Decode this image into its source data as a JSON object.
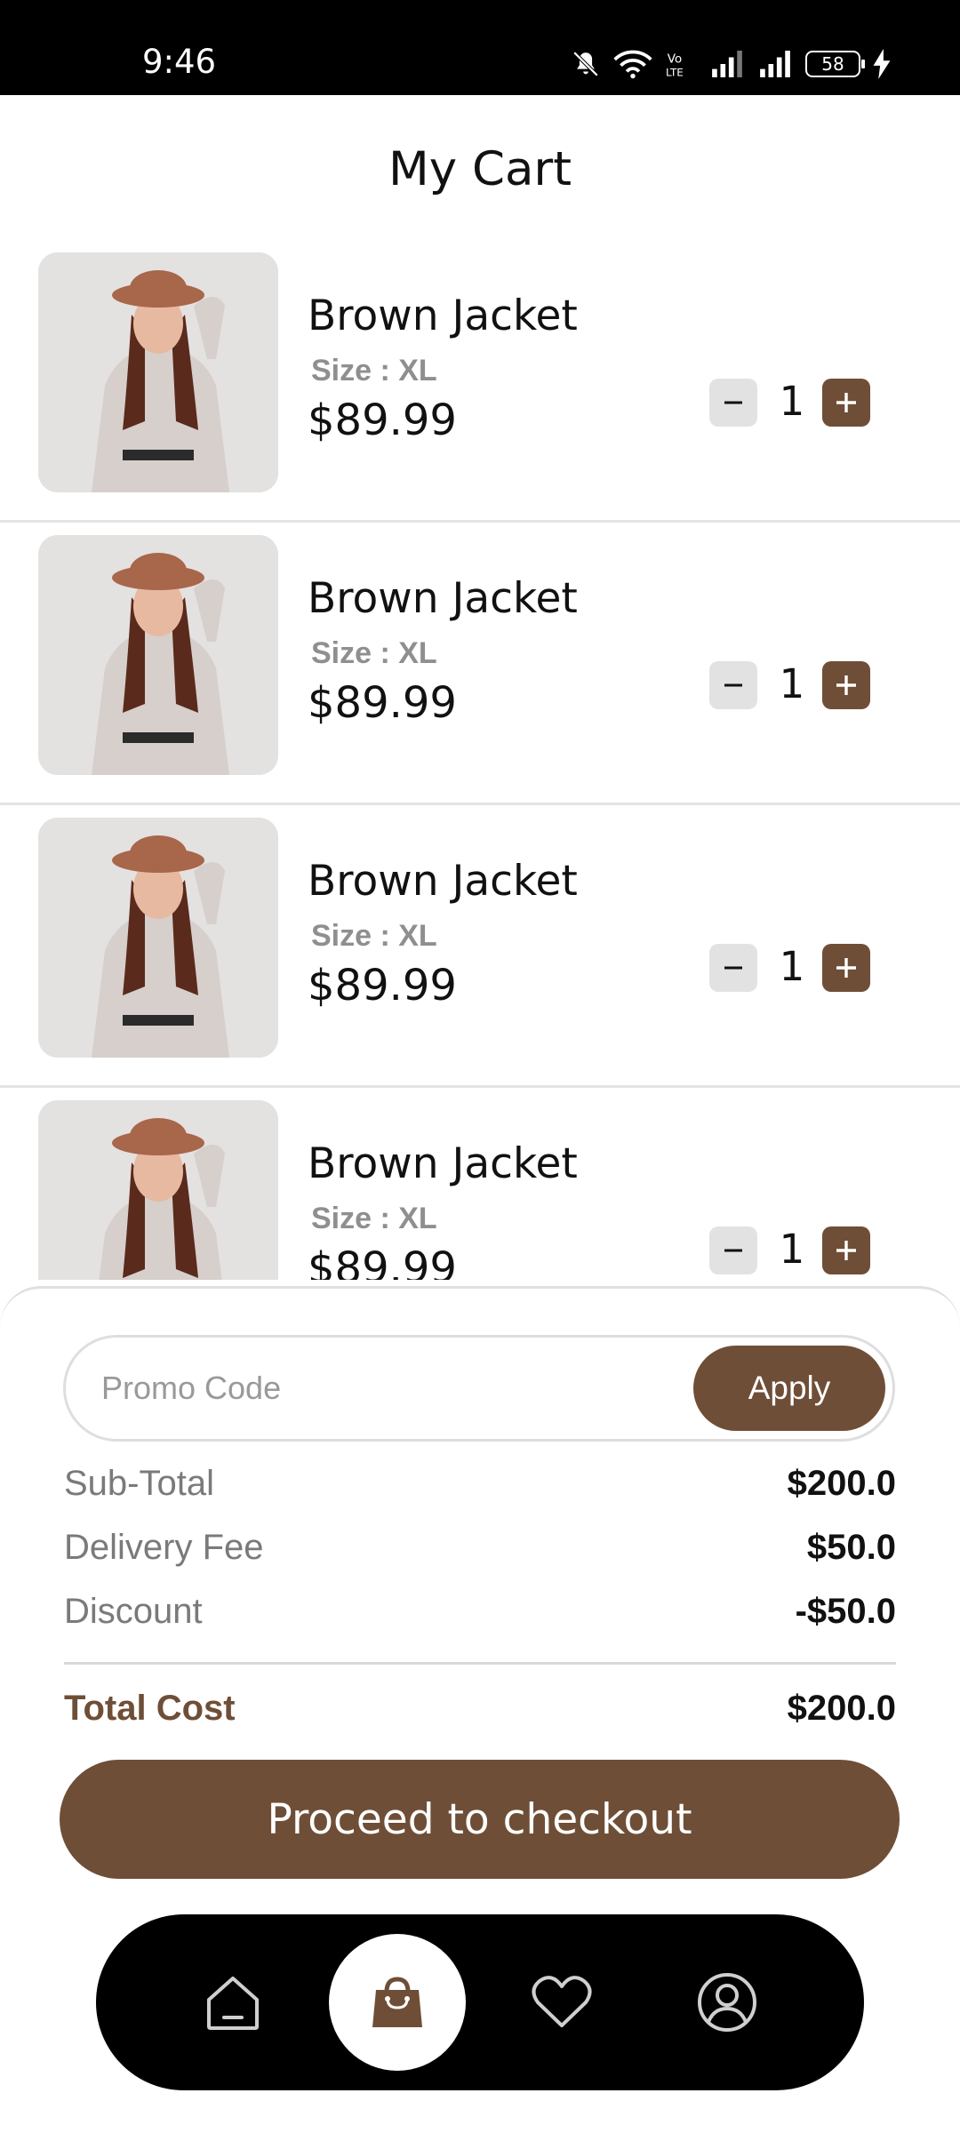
{
  "status": {
    "time": "9:46",
    "battery": "58"
  },
  "header": {
    "title": "My Cart"
  },
  "cart": {
    "items": [
      {
        "name": "Brown Jacket",
        "size": "Size : XL",
        "price": "$89.99",
        "qty": "1"
      },
      {
        "name": "Brown Jacket",
        "size": "Size : XL",
        "price": "$89.99",
        "qty": "1"
      },
      {
        "name": "Brown Jacket",
        "size": "Size : XL",
        "price": "$89.99",
        "qty": "1"
      },
      {
        "name": "Brown Jacket",
        "size": "Size : XL",
        "price": "$89.99",
        "qty": "1"
      }
    ]
  },
  "summary": {
    "promo_placeholder": "Promo Code",
    "apply_label": "Apply",
    "subtotal_label": "Sub-Total",
    "subtotal_value": "$200.0",
    "delivery_label": "Delivery Fee",
    "delivery_value": "$50.0",
    "discount_label": "Discount",
    "discount_value": "-$50.0",
    "total_label": "Total Cost",
    "total_value": "$200.0",
    "checkout_label": "Proceed to checkout"
  },
  "nav": {
    "items": [
      "home-icon",
      "shopping-bag-icon",
      "heart-icon",
      "profile-icon"
    ],
    "active": "shopping-bag-icon"
  },
  "colors": {
    "accent": "#6f4e37",
    "qty_minus_bg": "#e2e2e2",
    "nav_bg": "#000000"
  }
}
